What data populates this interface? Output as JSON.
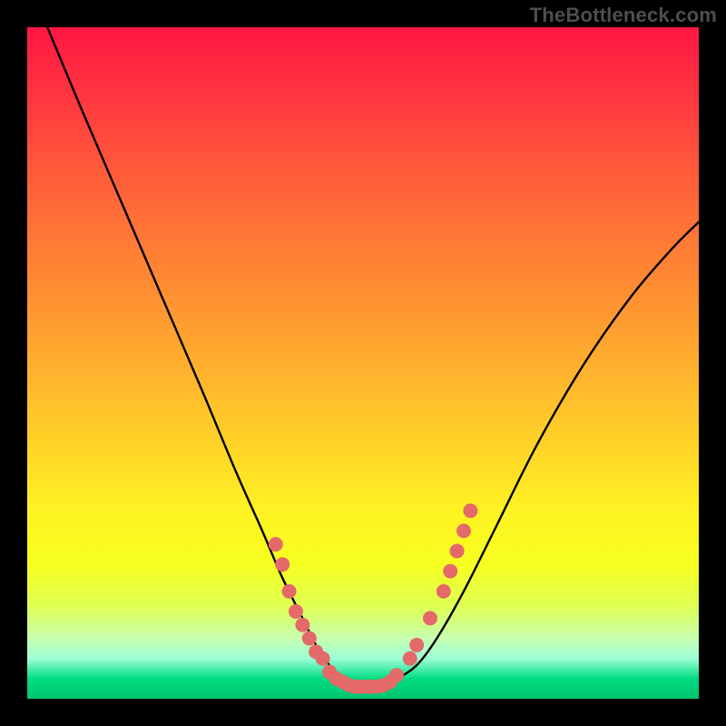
{
  "watermark": "TheBottleneck.com",
  "chart_data": {
    "type": "line",
    "title": "",
    "xlabel": "",
    "ylabel": "",
    "xlim": [
      0,
      100
    ],
    "ylim": [
      0,
      100
    ],
    "grid": false,
    "legend": false,
    "series": [
      {
        "name": "curve",
        "x": [
          3,
          8,
          14,
          20,
          26,
          31,
          35,
          38,
          41,
          43,
          45,
          47,
          49,
          52,
          55,
          58,
          61,
          65,
          70,
          76,
          83,
          90,
          96,
          100
        ],
        "y": [
          100,
          88,
          74,
          60,
          46,
          34,
          25,
          18,
          12,
          8,
          5,
          3,
          2,
          2,
          3,
          5,
          9,
          16,
          26,
          38,
          50,
          60,
          67,
          71
        ]
      }
    ],
    "markers": [
      {
        "x": 37,
        "y": 23
      },
      {
        "x": 38,
        "y": 20
      },
      {
        "x": 39,
        "y": 16
      },
      {
        "x": 40,
        "y": 13
      },
      {
        "x": 41,
        "y": 11
      },
      {
        "x": 42,
        "y": 9
      },
      {
        "x": 43,
        "y": 7
      },
      {
        "x": 44,
        "y": 6
      },
      {
        "x": 45,
        "y": 4
      },
      {
        "x": 46,
        "y": 3
      },
      {
        "x": 47,
        "y": 2.5
      },
      {
        "x": 48,
        "y": 2
      },
      {
        "x": 49,
        "y": 1.8
      },
      {
        "x": 50,
        "y": 1.8
      },
      {
        "x": 51,
        "y": 1.8
      },
      {
        "x": 52,
        "y": 1.8
      },
      {
        "x": 53,
        "y": 2
      },
      {
        "x": 54,
        "y": 2.5
      },
      {
        "x": 55,
        "y": 3.5
      },
      {
        "x": 57,
        "y": 6
      },
      {
        "x": 58,
        "y": 8
      },
      {
        "x": 60,
        "y": 12
      },
      {
        "x": 62,
        "y": 16
      },
      {
        "x": 63,
        "y": 19
      },
      {
        "x": 64,
        "y": 22
      },
      {
        "x": 65,
        "y": 25
      },
      {
        "x": 66,
        "y": 28
      }
    ],
    "marker_style": {
      "radius": 8,
      "fill": "#e46a6a",
      "stroke": "none"
    },
    "line_style": {
      "stroke": "#000000",
      "width": 2.4
    }
  }
}
